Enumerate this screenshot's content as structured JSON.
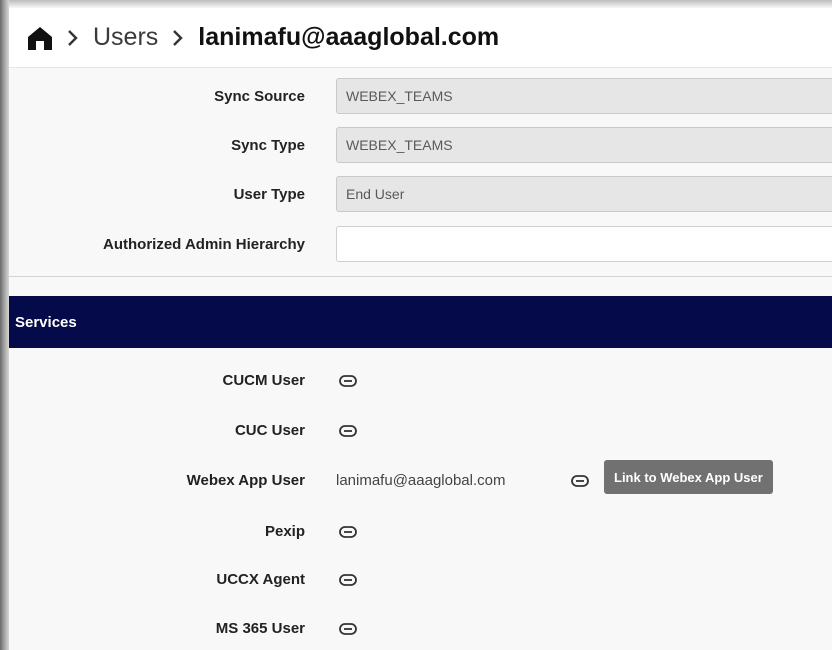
{
  "breadcrumb": {
    "home_icon": "home-icon",
    "separator_icon": "chevron-right-icon",
    "items": [
      "Users",
      "lanimafu@aaaglobal.com"
    ]
  },
  "form": {
    "rows": [
      {
        "label": "Sync Source",
        "value": "WEBEX_TEAMS",
        "readonly": true
      },
      {
        "label": "Sync Type",
        "value": "WEBEX_TEAMS",
        "readonly": true
      },
      {
        "label": "User Type",
        "value": "End User",
        "readonly": true
      },
      {
        "label": "Authorized Admin Hierarchy",
        "value": "",
        "readonly": false
      }
    ]
  },
  "services": {
    "title": "Services",
    "header_color": "#050a4a",
    "rows": [
      {
        "label": "CUCM User",
        "icon": "link-icon"
      },
      {
        "label": "CUC User",
        "icon": "link-icon"
      },
      {
        "label": "Webex App User",
        "value": "lanimafu@aaaglobal.com",
        "icon": "link-icon",
        "tooltip": "Link to Webex App User"
      },
      {
        "label": "Pexip",
        "icon": "link-icon"
      },
      {
        "label": "UCCX Agent",
        "icon": "link-icon"
      },
      {
        "label": "MS 365 User",
        "icon": "link-icon"
      }
    ]
  }
}
